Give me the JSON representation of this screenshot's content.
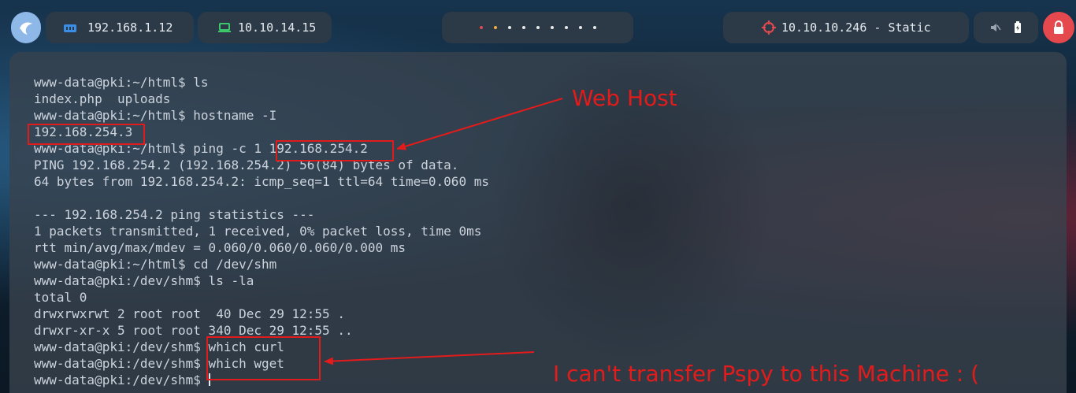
{
  "topbar": {
    "local_ip": "192.168.1.12",
    "vpn_ip": "10.10.14.15",
    "workspace_dots": [
      "#e5484d",
      "#f2b03a",
      "#e8e8e8",
      "#e8e8e8",
      "#e8e8e8",
      "#e8e8e8",
      "#e8e8e8",
      "#e8e8e8",
      "#e8e8e8"
    ],
    "target": "10.10.10.246 - Static",
    "icons": [
      "launcher-icon",
      "network-icon",
      "monitor-icon",
      "crosshair-icon",
      "mute-icon",
      "battery-icon",
      "lock-icon"
    ]
  },
  "terminal": {
    "lines": [
      "www-data@pki:~/html$ ls",
      "index.php  uploads",
      "www-data@pki:~/html$ hostname -I",
      "192.168.254.3",
      "www-data@pki:~/html$ ping -c 1 192.168.254.2",
      "PING 192.168.254.2 (192.168.254.2) 56(84) bytes of data.",
      "64 bytes from 192.168.254.2: icmp_seq=1 ttl=64 time=0.060 ms",
      "",
      "--- 192.168.254.2 ping statistics ---",
      "1 packets transmitted, 1 received, 0% packet loss, time 0ms",
      "rtt min/avg/max/mdev = 0.060/0.060/0.060/0.000 ms",
      "www-data@pki:~/html$ cd /dev/shm",
      "www-data@pki:/dev/shm$ ls -la",
      "total 0",
      "drwxrwxrwt 2 root root  40 Dec 29 12:55 .",
      "drwxr-xr-x 5 root root 340 Dec 29 12:55 ..",
      "www-data@pki:/dev/shm$ which curl",
      "www-data@pki:/dev/shm$ which wget",
      "www-data@pki:/dev/shm$ "
    ]
  },
  "annotations": {
    "web_host": "Web Host",
    "no_transfer": "I can't transfer Pspy to this Machine : (",
    "color": "#e31b1b"
  }
}
